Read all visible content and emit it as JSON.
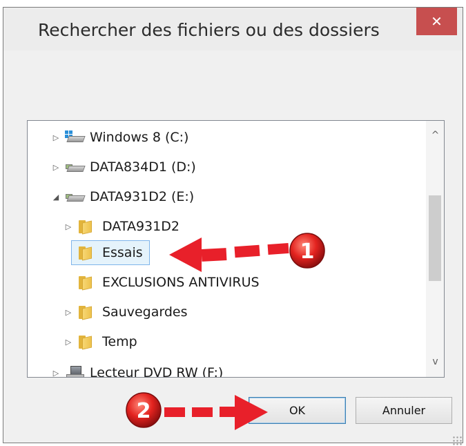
{
  "window": {
    "title": "Rechercher des fichiers ou des dossiers",
    "close_glyph": "✕"
  },
  "tree": {
    "items": [
      {
        "label": "Windows 8 (C:)",
        "expander": "▷",
        "icon": "system-drive-icon"
      },
      {
        "label": "DATA834D1 (D:)",
        "expander": "▷",
        "icon": "drive-icon"
      },
      {
        "label": "DATA931D2 (E:)",
        "expander": "◢",
        "icon": "drive-icon"
      },
      {
        "label": "DATA931D2",
        "expander": "▷",
        "icon": "folder-icon"
      },
      {
        "label": "Essais",
        "expander": "",
        "icon": "folder-icon",
        "selected": true
      },
      {
        "label": "EXCLUSIONS ANTIVIRUS",
        "expander": "",
        "icon": "folder-icon"
      },
      {
        "label": "Sauvegardes",
        "expander": "▷",
        "icon": "folder-icon"
      },
      {
        "label": "Temp",
        "expander": "▷",
        "icon": "folder-icon"
      },
      {
        "label": "Lecteur DVD RW (F:)",
        "expander": "▷",
        "icon": "dvd-drive-icon"
      }
    ],
    "scroll_up_glyph": "^",
    "scroll_down_glyph": "v"
  },
  "buttons": {
    "ok_label": "OK",
    "cancel_label": "Annuler"
  },
  "annotations": {
    "badge_1": "1",
    "badge_2": "2",
    "accent_color": "#e8202a"
  }
}
